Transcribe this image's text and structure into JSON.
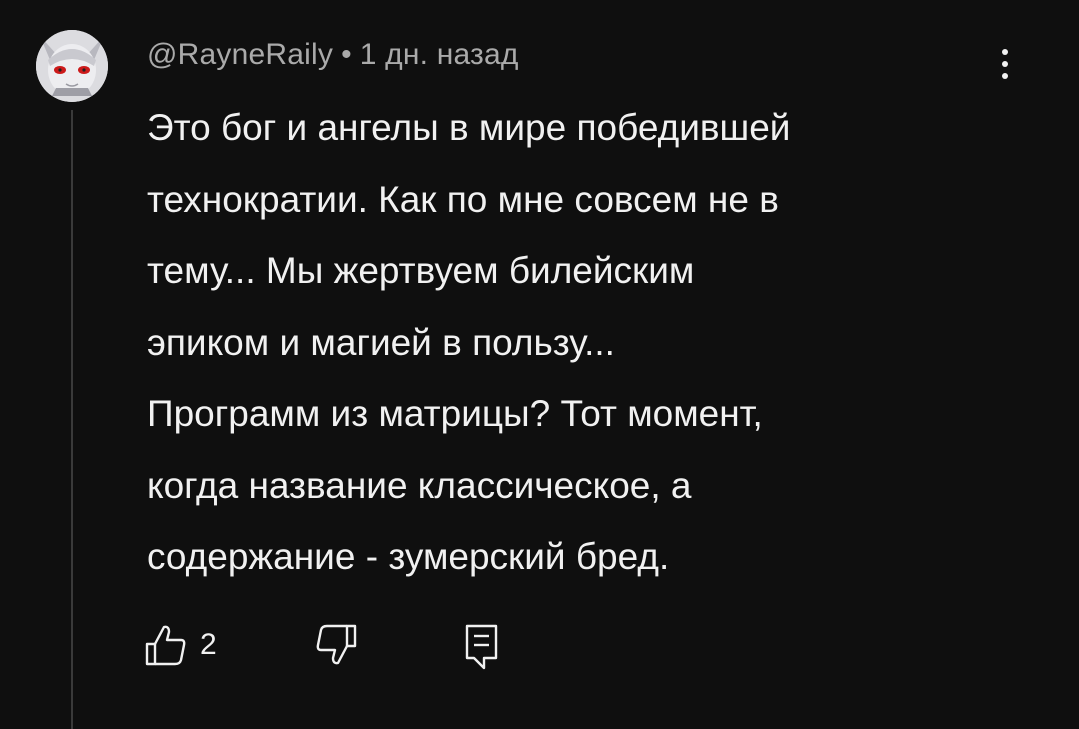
{
  "comment": {
    "author": "@RayneRaily",
    "separator": "•",
    "timestamp": "1 дн. назад",
    "text_lines": [
      "Это бог и ангелы в мире победившей",
      "технократии. Как по мне совсем не в",
      "тему... Мы жертвуем билейским",
      "эпиком и магией в пользу...",
      "Программ из матрицы? Тот момент,",
      "когда название классическое, а",
      "содержание - зумерский бред."
    ],
    "like_count": "2"
  },
  "icons": {
    "like": "thumbs-up-outline-icon",
    "dislike": "thumbs-down-outline-icon",
    "reply": "reply-comment-icon",
    "menu": "more-vertical-icon"
  },
  "colors": {
    "background": "#0f0f0f",
    "text_primary": "#f1f1f1",
    "text_secondary": "#aaaaaa",
    "thread_line": "#3a3a3a"
  }
}
